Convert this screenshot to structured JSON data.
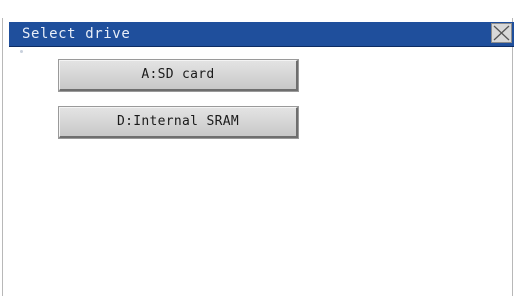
{
  "dialog": {
    "title": "Select drive",
    "close_label": "close"
  },
  "drives": [
    {
      "label": "A:SD card"
    },
    {
      "label": "D:Internal SRAM"
    }
  ],
  "colors": {
    "titlebar": "#1f4f9c",
    "button_face": "#d3d3d3"
  }
}
